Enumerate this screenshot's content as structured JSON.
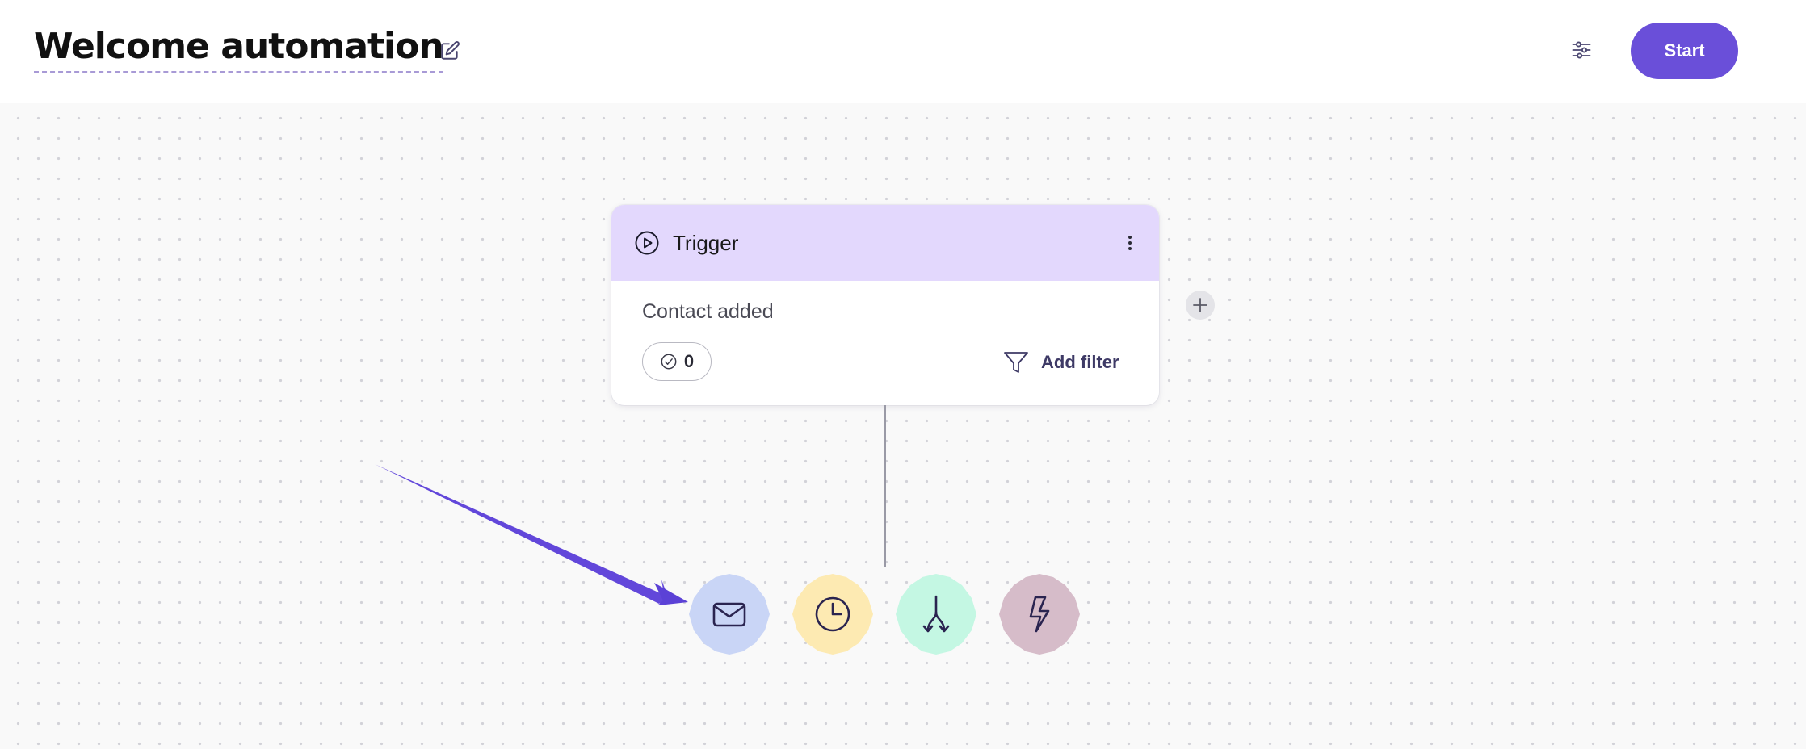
{
  "header": {
    "title": "Welcome automation",
    "start_label": "Start"
  },
  "trigger_card": {
    "title": "Trigger",
    "description": "Contact added",
    "count": "0",
    "add_filter_label": "Add filter"
  },
  "colors": {
    "accent": "#6a4fd9",
    "card_header": "#e3d8fd",
    "email_action": "#c9d5f6",
    "delay_action": "#fdeab2",
    "split_action": "#c4f7e3",
    "webhook_action": "#d6bcc9",
    "icon_stroke": "#2a2450"
  },
  "icons": {
    "edit": "pencil-edit-icon",
    "settings": "sliders-icon",
    "trigger": "play-circle-icon",
    "menu": "vertical-dots-icon",
    "count": "check-circle-icon",
    "filter": "funnel-icon",
    "add": "plus-icon",
    "email": "envelope-icon",
    "delay": "clock-icon",
    "split": "branch-split-icon",
    "webhook": "lightning-bolt-icon",
    "pointer": "annotation-arrow-icon"
  }
}
